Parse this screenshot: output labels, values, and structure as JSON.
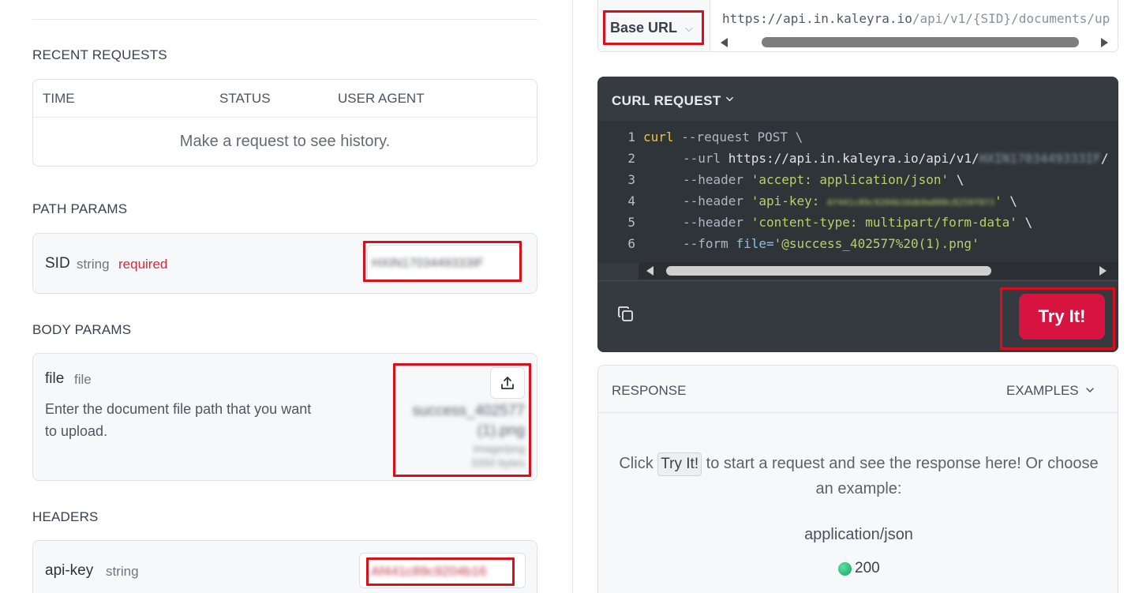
{
  "recent_requests": {
    "title": "RECENT REQUESTS",
    "columns": [
      "TIME",
      "STATUS",
      "USER AGENT"
    ],
    "empty_message": "Make a request to see history."
  },
  "path_params": {
    "title": "PATH PARAMS",
    "sid": {
      "name": "SID",
      "type": "string",
      "required_label": "required",
      "value": "HXIN1703449333IF"
    }
  },
  "body_params": {
    "title": "BODY PARAMS",
    "file": {
      "name": "file",
      "type": "file",
      "description": "Enter the document file path that you want to upload.",
      "selected_name_line1": "success_402577",
      "selected_name_line2": "(1).png",
      "selected_mime": "image/png",
      "selected_size": "3350 bytes"
    }
  },
  "headers": {
    "title": "HEADERS",
    "api_key": {
      "name": "api-key",
      "type": "string",
      "value": "Af441c89c9204b16"
    }
  },
  "base_url": {
    "label": "Base URL",
    "url_host": "https://api.in.kaleyra.io",
    "url_path": "/api/v1/{SID}/documents/up"
  },
  "curl": {
    "title": "CURL REQUEST",
    "lines": [
      {
        "num": "1",
        "cmd": "curl",
        "rest": " --request POST \\"
      },
      {
        "num": "2",
        "flag": "--url",
        "plain": " https://api.in.kaleyra.io/api/v1/",
        "blurred": "HXIN1703449333IF",
        "tail": "/"
      },
      {
        "num": "3",
        "flag": "--header",
        "str": "'accept: application/json'",
        "tail": " \\"
      },
      {
        "num": "4",
        "flag": "--header",
        "str": "'api-key: ",
        "blurred": "Af441c89c9204b16db9a000c8259f8f3",
        "str_end": "'",
        "tail": " \\"
      },
      {
        "num": "5",
        "flag": "--header",
        "str": "'content-type: multipart/form-data'",
        "tail": " \\"
      },
      {
        "num": "6",
        "flag": "--form",
        "attr": "file=",
        "str": "'@success_402577%20(1).png'"
      }
    ],
    "try_label": "Try It!"
  },
  "response": {
    "title": "RESPONSE",
    "examples_label": "EXAMPLES",
    "msg_before": "Click ",
    "msg_kbd": "Try It!",
    "msg_after": " to start a request and see the response here! Or choose an example:",
    "content_type": "application/json",
    "status_code": "200"
  }
}
